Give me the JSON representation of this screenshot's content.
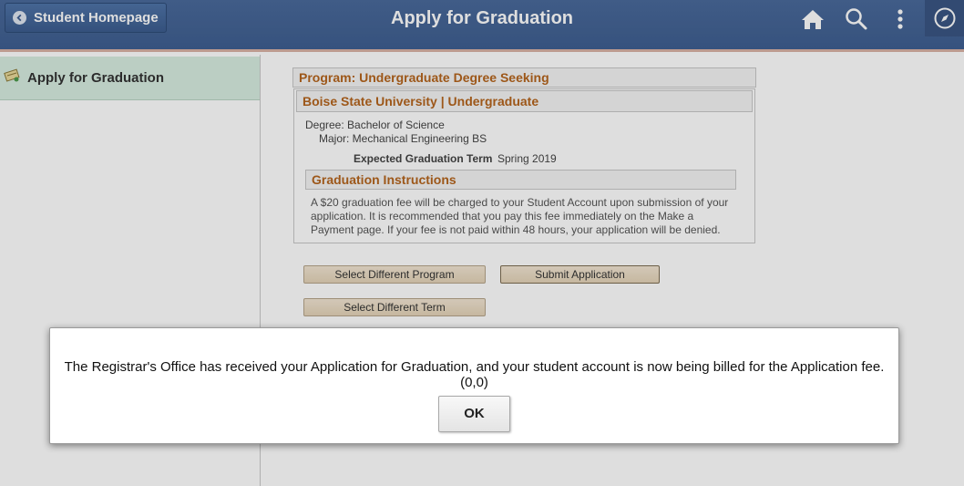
{
  "header": {
    "back_label": "Student Homepage",
    "title": "Apply for Graduation",
    "icons": [
      "home-icon",
      "search-icon",
      "more-vertical-icon",
      "navbar-compass-icon"
    ]
  },
  "left_panel": {
    "item_label": "Apply for Graduation",
    "item_icon": "diploma-icon"
  },
  "program": {
    "program_title": "Program: Undergraduate Degree Seeking",
    "institution": "Boise State University | Undergraduate",
    "degree": "Degree: Bachelor of Science",
    "major": "Major: Mechanical Engineering BS",
    "expected_term_label": "Expected Graduation Term",
    "expected_term_value": "Spring 2019",
    "instructions_title": "Graduation Instructions",
    "instructions_text": "A $20 graduation fee will be charged to your Student Account upon submission of your application. It is recommended that you pay this fee immediately on the Make a Payment page. If your fee is not paid within 48 hours, your application will be denied."
  },
  "buttons": {
    "select_program": "Select Different Program",
    "submit": "Submit Application",
    "select_term": "Select Different Term"
  },
  "dialog": {
    "message": "The Registrar's Office has received your Application for Graduation, and your student account is now being billed for the Application fee. (0,0)",
    "ok_label": "OK"
  },
  "colors": {
    "header_bg": "#4a6a9b",
    "section_title": "#b5651d",
    "left_item_bg": "#d7ede1",
    "button_bg": "#e4d3b8"
  }
}
